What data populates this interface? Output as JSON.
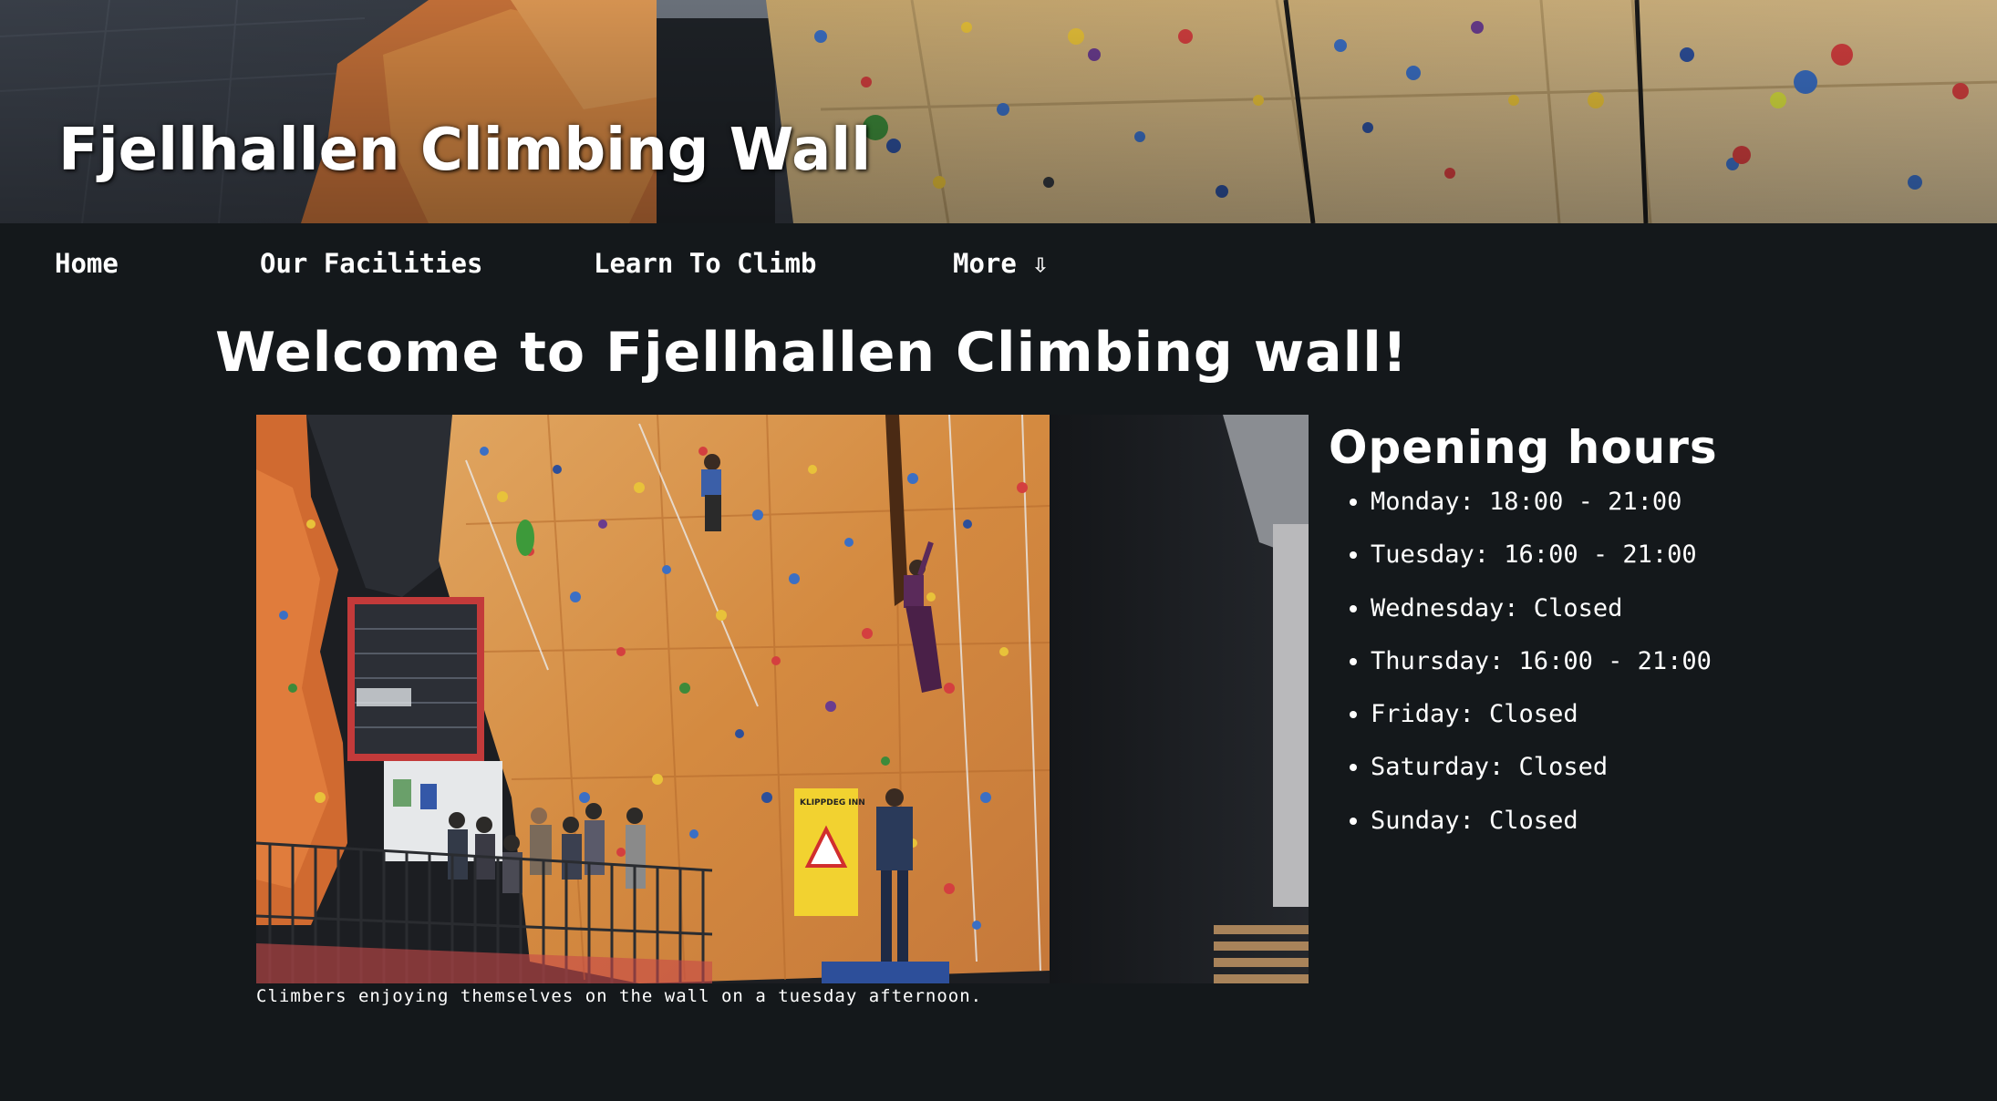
{
  "site": {
    "title": "Fjellhallen Climbing Wall"
  },
  "nav": {
    "items": [
      {
        "label": "Home"
      },
      {
        "label": "Our Facilities"
      },
      {
        "label": "Learn To Climb"
      },
      {
        "label": "More ⇩"
      }
    ]
  },
  "main": {
    "heading": "Welcome to Fjellhallen Climbing wall!",
    "photo": {
      "caption": "Climbers enjoying themselves on the wall on a tuesday afternoon.",
      "sign_text": "KLIPPDEG INN"
    }
  },
  "hours": {
    "title": "Opening hours",
    "items": [
      "Monday: 18:00 - 21:00",
      "Tuesday: 16:00 - 21:00",
      "Wednesday: Closed",
      "Thursday: 16:00 - 21:00",
      "Friday: Closed",
      "Saturday: Closed",
      "Sunday: Closed"
    ]
  },
  "colors": {
    "background": "#14181b",
    "text": "#ffffff",
    "wall_orange": "#d98a3a",
    "wall_beige": "#cdb58a"
  }
}
